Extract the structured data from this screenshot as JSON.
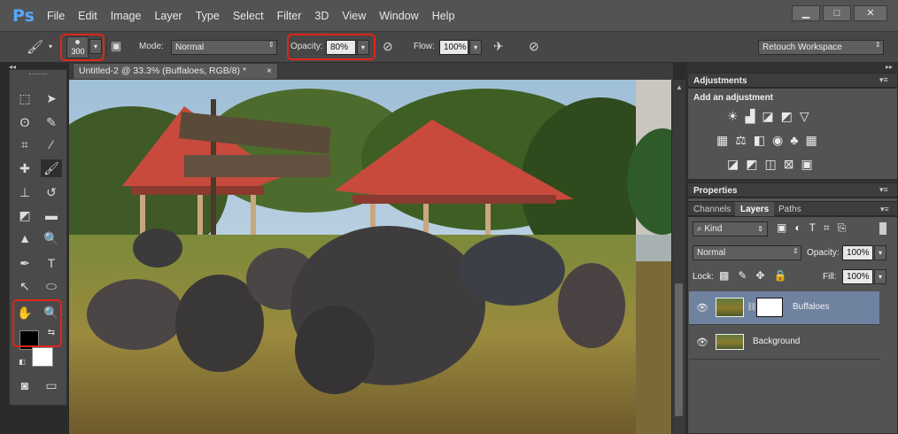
{
  "app": {
    "logo": "Ps"
  },
  "menu": [
    "File",
    "Edit",
    "Image",
    "Layer",
    "Type",
    "Select",
    "Filter",
    "3D",
    "View",
    "Window",
    "Help"
  ],
  "window_buttons": [
    "▁",
    "□",
    "✕"
  ],
  "options": {
    "brush_size": "300",
    "mode_label": "Mode:",
    "mode_value": "Normal",
    "opacity_label": "Opacity:",
    "opacity_value": "80%",
    "flow_label": "Flow:",
    "flow_value": "100%",
    "workspace": "Retouch Workspace"
  },
  "document": {
    "tab_title": "Untitled-2 @ 33.3% (Buffaloes, RGB/8) *",
    "tab_close": "×"
  },
  "panels": {
    "adjustments_title": "Adjustments",
    "add_adjustment": "Add an adjustment",
    "properties_title": "Properties",
    "tabs": [
      "Channels",
      "Layers",
      "Paths"
    ],
    "kind_label": "Kind",
    "blend_mode": "Normal",
    "opacity_label": "Opacity:",
    "opacity_value": "100%",
    "lock_label": "Lock:",
    "fill_label": "Fill:",
    "fill_value": "100%",
    "layers": [
      {
        "name": "Buffaloes",
        "active": true
      },
      {
        "name": "Background",
        "active": false
      }
    ]
  },
  "colors": {
    "highlight": "#e2231a",
    "foreground": "#000000",
    "background": "#ffffff",
    "active_layer": "#6f82a0",
    "roof": "#c74a3c"
  }
}
